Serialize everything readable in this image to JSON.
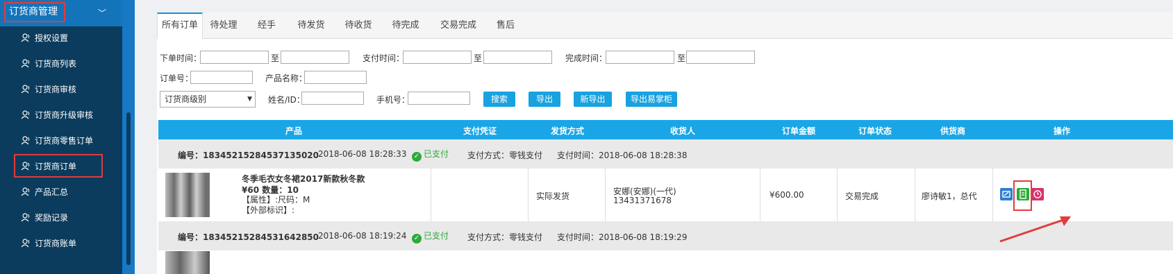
{
  "sidebar": {
    "title": "订货商管理",
    "items": [
      {
        "label": "授权设置"
      },
      {
        "label": "订货商列表"
      },
      {
        "label": "订货商审核"
      },
      {
        "label": "订货商升级审核"
      },
      {
        "label": "订货商零售订单"
      },
      {
        "label": "订货商订单"
      },
      {
        "label": "产品汇总"
      },
      {
        "label": "奖励记录"
      },
      {
        "label": "订货商账单"
      }
    ]
  },
  "tabs": [
    "所有订单",
    "待处理",
    "经手",
    "待发货",
    "待收货",
    "待完成",
    "交易完成",
    "售后"
  ],
  "filters": {
    "order_time": "下单时间：",
    "to1": "至",
    "pay_time": "支付时间：",
    "to2": "至",
    "done_time": "完成时间：",
    "to3": "至",
    "order_no": "订单号：",
    "product_name": "产品名称：",
    "level_select": "订货商级别",
    "name_id": "姓名/ID：",
    "phone": "手机号："
  },
  "buttons": {
    "search": "搜索",
    "export": "导出",
    "new_export": "新导出",
    "export_easy": "导出易掌柜"
  },
  "table_headers": [
    "产品",
    "支付凭证",
    "发货方式",
    "收货人",
    "订单金额",
    "订单状态",
    "供货商",
    "操作"
  ],
  "orders": [
    {
      "number": "编号：18345215284537135020",
      "created": "2018-06-08 18:28:33",
      "status_paid": "已支付",
      "pay_method": "支付方式：零钱支付",
      "pay_time": "支付时间：2018-06-08 18:28:38",
      "product_title": "冬季毛衣女冬裙2017新款秋冬款",
      "price_qty": "¥60 数量：10",
      "attr": "【属性】:尺码：M",
      "ext": "【外部标识】:",
      "shipping": "实际发货",
      "receiver": "安娜(安娜)(一代)",
      "receiver_phone": "13431371678",
      "amount": "¥600.00",
      "status": "交易完成",
      "supplier": "廖诗敏1，总代"
    },
    {
      "number": "编号：18345215284531642850",
      "created": "2018-06-08 18:19:24",
      "status_paid": "已支付",
      "pay_method": "支付方式：零钱支付",
      "pay_time": "支付时间：2018-06-08 18:19:29"
    }
  ],
  "colors": {
    "sidebar": "#0b3c5d",
    "accent": "#1aa6e6",
    "highlight": "#e33b3b",
    "paid": "#2daa3a"
  }
}
